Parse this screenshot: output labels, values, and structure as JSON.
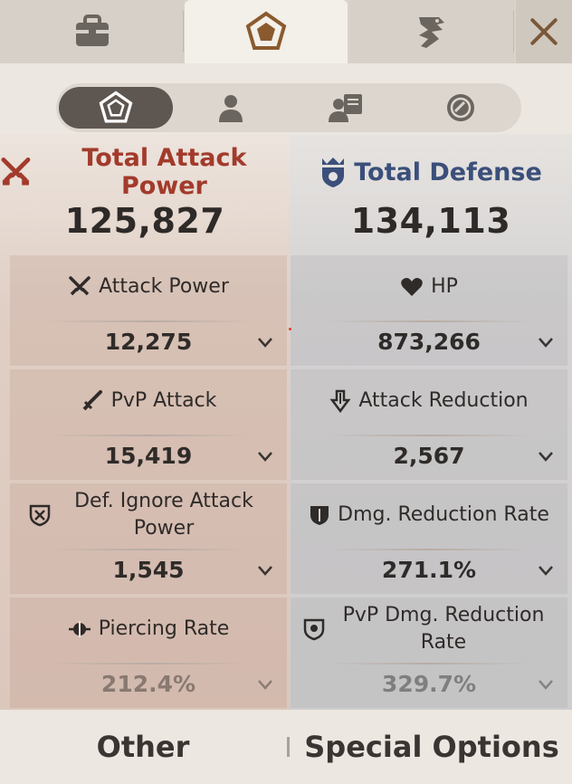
{
  "top_tabs": [
    {
      "name": "inventory-bag-icon"
    },
    {
      "name": "pentagon-stats-icon",
      "active": true
    },
    {
      "name": "dragon-icon"
    }
  ],
  "sub_tabs": [
    {
      "name": "pentagon-stats-icon",
      "active": true
    },
    {
      "name": "character-icon"
    },
    {
      "name": "npc-card-icon"
    },
    {
      "name": "coin-icon"
    }
  ],
  "summary": {
    "attack": {
      "label": "Total Attack Power",
      "value": "125,827"
    },
    "defense": {
      "label": "Total Defense",
      "value": "134,113"
    }
  },
  "attack_stats": [
    {
      "label": "Attack Power",
      "value": "12,275",
      "icon": "crossed-swords-icon"
    },
    {
      "label": "PvP Attack",
      "value": "15,419",
      "icon": "sword-icon"
    },
    {
      "label": "Def. Ignore Attack Power",
      "value": "1,545",
      "icon": "shield-crossed-icon"
    },
    {
      "label": "Piercing Rate",
      "value": "212.4%",
      "icon": "piercing-icon"
    }
  ],
  "defense_stats": [
    {
      "label": "HP",
      "value": "873,266",
      "icon": "heart-icon"
    },
    {
      "label": "Attack Reduction",
      "value": "2,567",
      "icon": "down-arrow-icon"
    },
    {
      "label": "Dmg. Reduction Rate",
      "value": "271.1%",
      "icon": "shield-icon"
    },
    {
      "label": "PvP Dmg. Reduction Rate",
      "value": "329.7%",
      "icon": "pvp-shield-icon"
    }
  ],
  "bottom": {
    "other_label": "Other",
    "special_label": "Special Options"
  },
  "colors": {
    "attack": "#a23b2c",
    "defense": "#3b4f7a",
    "accent_brown": "#7a5838"
  }
}
